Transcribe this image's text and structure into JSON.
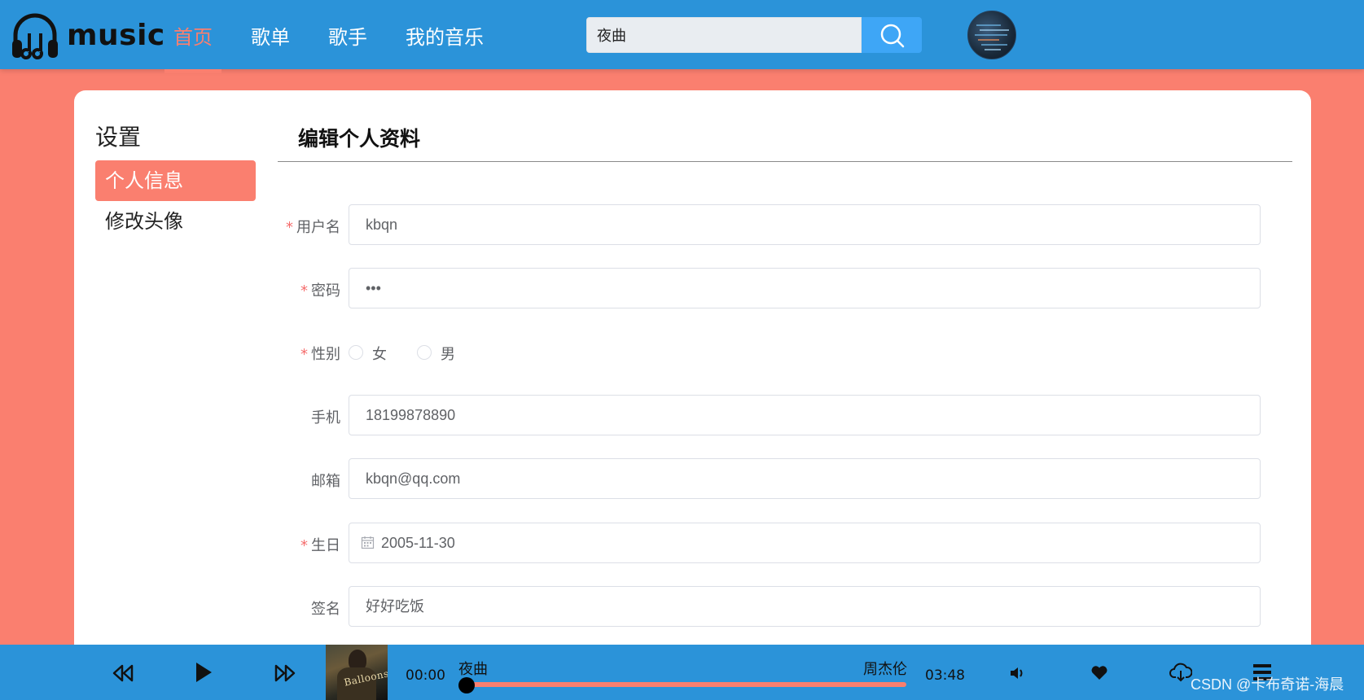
{
  "header": {
    "logo_text": "music",
    "nav": [
      "首页",
      "歌单",
      "歌手",
      "我的音乐"
    ],
    "active_nav": "首页",
    "search_value": "夜曲",
    "colors": {
      "bar": "#2b93d9",
      "accent": "#fa7f6f",
      "search_button": "#3ea6f6"
    }
  },
  "sidebar": {
    "title": "设置",
    "items": [
      {
        "label": "个人信息",
        "active": true
      },
      {
        "label": "修改头像",
        "active": false
      }
    ]
  },
  "form": {
    "title": "编辑个人资料",
    "required_mark": "*",
    "fields": {
      "username": {
        "label": "用户名",
        "value": "kbqn",
        "required": true
      },
      "password": {
        "label": "密码",
        "value": "•••",
        "required": true
      },
      "gender": {
        "label": "性别",
        "options": [
          "女",
          "男"
        ],
        "required": true
      },
      "phone": {
        "label": "手机",
        "value": "18199878890",
        "required": false
      },
      "email": {
        "label": "邮箱",
        "value": "kbqn@qq.com",
        "required": false
      },
      "birthday": {
        "label": "生日",
        "value": "2005-11-30",
        "required": true,
        "icon": "calendar-icon"
      },
      "signature": {
        "label": "签名",
        "value": "好好吃饭",
        "required": false
      }
    }
  },
  "player": {
    "current_time": "00:00",
    "duration": "03:48",
    "song": "夜曲",
    "artist": "周杰伦",
    "progress": 0,
    "cover_text": "Balloons",
    "icons": [
      "prev-icon",
      "play-icon",
      "next-icon",
      "volume-icon",
      "heart-icon",
      "download-icon",
      "playlist-icon"
    ]
  },
  "watermark": "CSDN @卡布奇诺-海晨"
}
